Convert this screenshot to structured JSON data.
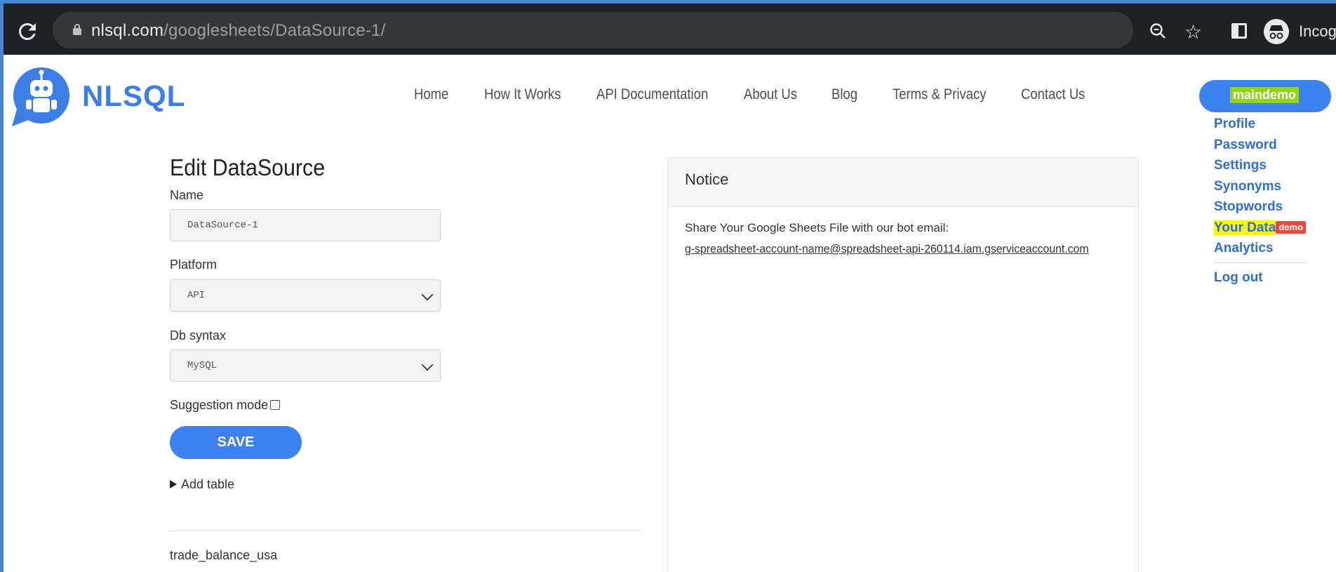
{
  "browser": {
    "url_domain": "nlsql.com",
    "url_path": "/googlesheets/DataSource-1/",
    "profile_label": "Incognito"
  },
  "site": {
    "logo_text": "NLSQL",
    "nav": [
      "Home",
      "How It Works",
      "API Documentation",
      "About Us",
      "Blog",
      "Terms & Privacy",
      "Contact Us"
    ]
  },
  "user_menu": {
    "username": "maindemo",
    "items": [
      "Profile",
      "Password",
      "Settings",
      "Synonyms",
      "Stopwords"
    ],
    "your_data_label": "Your Data",
    "your_data_badge": "demo",
    "analytics": "Analytics",
    "logout": "Log out"
  },
  "form": {
    "title": "Edit DataSource",
    "name_label": "Name",
    "name_value": "DataSource-1",
    "platform_label": "Platform",
    "platform_value": "API",
    "syntax_label": "Db syntax",
    "syntax_value": "MySQL",
    "suggestion_label": "Suggestion mode",
    "suggestion_checked": false,
    "save_label": "SAVE",
    "add_table_label": "Add table",
    "table_name": "trade_balance_usa"
  },
  "notice": {
    "title": "Notice",
    "text": "Share Your Google Sheets File with our bot email:",
    "email": "g-spreadsheet-account-name@spreadsheet-api-260114.iam.gserviceaccount.com"
  },
  "colors": {
    "accent": "#3b82f0",
    "logo": "#3b7fe6",
    "highlight": "#f8f516",
    "badge": "#e84a3c"
  }
}
